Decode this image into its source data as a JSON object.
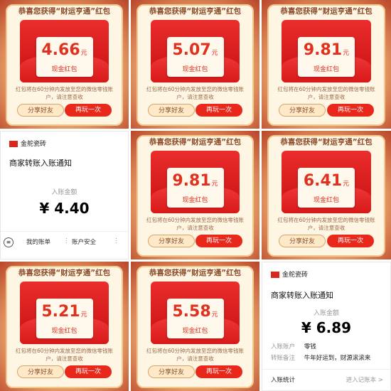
{
  "packet": {
    "title": "恭喜您获得“财运亨通”红包",
    "card_label": "现金红包",
    "unit": "元",
    "note": "红包将在60分钟内发放至您的微信零钱账户，请注意查收",
    "share_label": "分享好友",
    "again_label": "再玩一次"
  },
  "amounts": [
    "4.66",
    "5.07",
    "9.81",
    "9.81",
    "6.41",
    "5.21",
    "5.58"
  ],
  "notice1": {
    "merchant": "金舵瓷砖",
    "title": "商家转账入账通知",
    "amount_label": "入账金额",
    "amount": "¥ 4.40",
    "footer": [
      "我的账单",
      "账户安全"
    ]
  },
  "notice2": {
    "merchant": "金舵瓷砖",
    "title": "商家转账入账通知",
    "amount_label": "入账金额",
    "amount": "¥ 6.89",
    "rows": [
      {
        "label": "入账账户",
        "value": "零钱"
      },
      {
        "label": "转账备注",
        "value": "牛年好运到，财源滚滚来"
      }
    ],
    "stats_label": "入账统计",
    "stats_link": "进入记账本 >"
  }
}
